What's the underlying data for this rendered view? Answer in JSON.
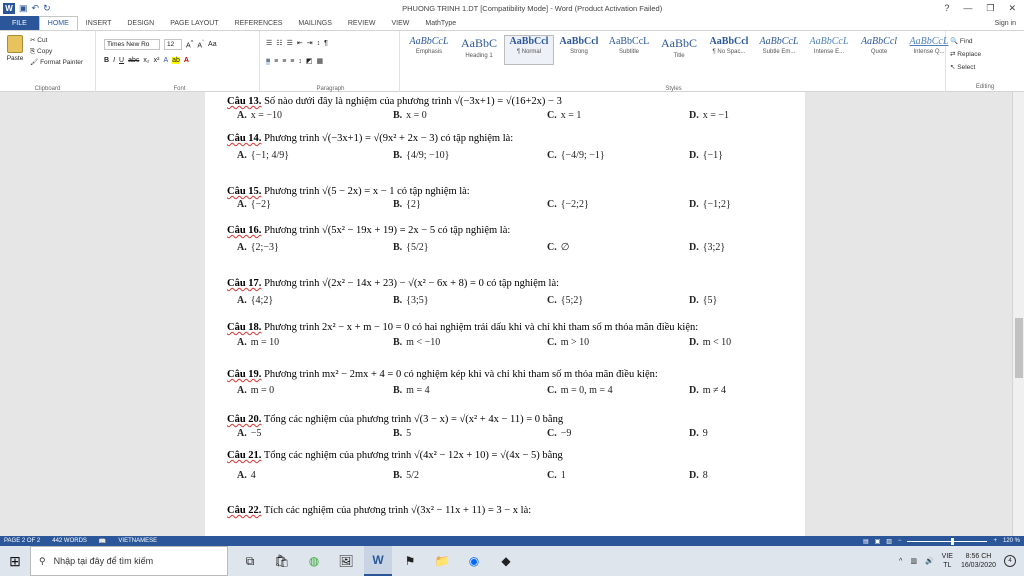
{
  "window": {
    "title": "PHUONG TRINH 1.DT [Compatibility Mode] - Word (Product Activation Failed)",
    "help": "?",
    "minimize": "—",
    "restore": "❐",
    "close": "✕"
  },
  "tabs": [
    "FILE",
    "HOME",
    "INSERT",
    "DESIGN",
    "PAGE LAYOUT",
    "REFERENCES",
    "MAILINGS",
    "REVIEW",
    "VIEW",
    "MathType"
  ],
  "signin": "Sign in",
  "clipboard": {
    "paste": "Paste",
    "cut": "Cut",
    "copy": "Copy",
    "format_painter": "Format Painter",
    "label": "Clipboard"
  },
  "font": {
    "name": "Times New Ro",
    "size": "12",
    "label": "Font"
  },
  "paragraph": {
    "label": "Paragraph"
  },
  "styles": {
    "label": "Styles",
    "items": [
      {
        "preview": "AaBbCcL",
        "name": "Emphasis"
      },
      {
        "preview": "AaBbC",
        "name": "Heading 1"
      },
      {
        "preview": "AaBbCcl",
        "name": "¶ Normal"
      },
      {
        "preview": "AaBbCcl",
        "name": "Strong"
      },
      {
        "preview": "AaBbCcL",
        "name": "Subtitle"
      },
      {
        "preview": "AaBbC",
        "name": "Title"
      },
      {
        "preview": "AaBbCcl",
        "name": "¶ No Spac..."
      },
      {
        "preview": "AaBbCcL",
        "name": "Subtle Em..."
      },
      {
        "preview": "AaBbCcL",
        "name": "Intense E..."
      },
      {
        "preview": "AaBbCcl",
        "name": "Quote"
      },
      {
        "preview": "AaBbCcL",
        "name": "Intense Q..."
      }
    ]
  },
  "editing": {
    "find": "Find",
    "replace": "Replace",
    "select": "Select",
    "label": "Editing"
  },
  "questions": [
    {
      "num": "Câu 13.",
      "text": "Số nào dưới đây là nghiệm của phương trình √(−3x+1) = √(16+2x) − 3",
      "opts": [
        "x = −10",
        "x = 0",
        "x = 1",
        "x = −1"
      ]
    },
    {
      "num": "Câu 14.",
      "text": "Phương trình √(−3x+1) = √(9x² + 2x − 3) có tập nghiệm là:",
      "opts": [
        "{−1; 4/9}",
        "{4/9; −10}",
        "{−4/9; −1}",
        "{−1}"
      ]
    },
    {
      "num": "Câu 15.",
      "text": "Phương trình √(5 − 2x) = x − 1 có tập nghiệm là:",
      "opts": [
        "{−2}",
        "{2}",
        "{−2;2}",
        "{−1;2}"
      ]
    },
    {
      "num": "Câu 16.",
      "text": "Phương trình √(5x² − 19x + 19) = 2x − 5 có tập nghiệm là:",
      "opts": [
        "{2;−3}",
        "{5/2}",
        "∅",
        "{3;2}"
      ]
    },
    {
      "num": "Câu 17.",
      "text": "Phương trình √(2x² − 14x + 23) − √(x² − 6x + 8) = 0 có tập nghiệm là:",
      "opts": [
        "{4;2}",
        "{3;5}",
        "{5;2}",
        "{5}"
      ]
    },
    {
      "num": "Câu 18.",
      "text": "Phương trình 2x² − x + m − 10 = 0 có hai nghiệm trái dấu khi và chỉ khi tham số m thỏa mãn điều kiện:",
      "opts": [
        "m = 10",
        "m < −10",
        "m > 10",
        "m < 10"
      ]
    },
    {
      "num": "Câu 19.",
      "text": "Phương trình mx² − 2mx + 4 = 0 có nghiệm kép khi và chỉ khi tham số m thỏa mãn điều kiện:",
      "opts": [
        "m = 0",
        "m = 4",
        "m = 0, m = 4",
        "m ≠ 4"
      ]
    },
    {
      "num": "Câu 20.",
      "text": "Tổng các nghiệm của phương trình √(3 − x) = √(x² + 4x − 11) = 0 bằng",
      "opts": [
        "−5",
        "5",
        "−9",
        "9"
      ]
    },
    {
      "num": "Câu 21.",
      "text": "Tổng các nghiệm của phương trình √(4x² − 12x + 10) = √(4x − 5) bằng",
      "opts": [
        "4",
        "5/2",
        "1",
        "8"
      ]
    },
    {
      "num": "Câu 22.",
      "text": "Tích các nghiệm của phương trình √(3x² − 11x + 11) = 3 − x là:",
      "opts": [
        "",
        "",
        "",
        ""
      ]
    }
  ],
  "option_letters": [
    "A.",
    "B.",
    "C.",
    "D."
  ],
  "status": {
    "page": "PAGE 2 OF 2",
    "words": "442 WORDS",
    "lang": "VIETNAMESE",
    "zoom": "120 %"
  },
  "taskbar": {
    "search_placeholder": "Nhập tại đây để tìm kiếm",
    "lang1": "VIE",
    "lang2": "TL",
    "time": "8:56 CH",
    "date": "16/03/2020",
    "notifications": "4"
  }
}
